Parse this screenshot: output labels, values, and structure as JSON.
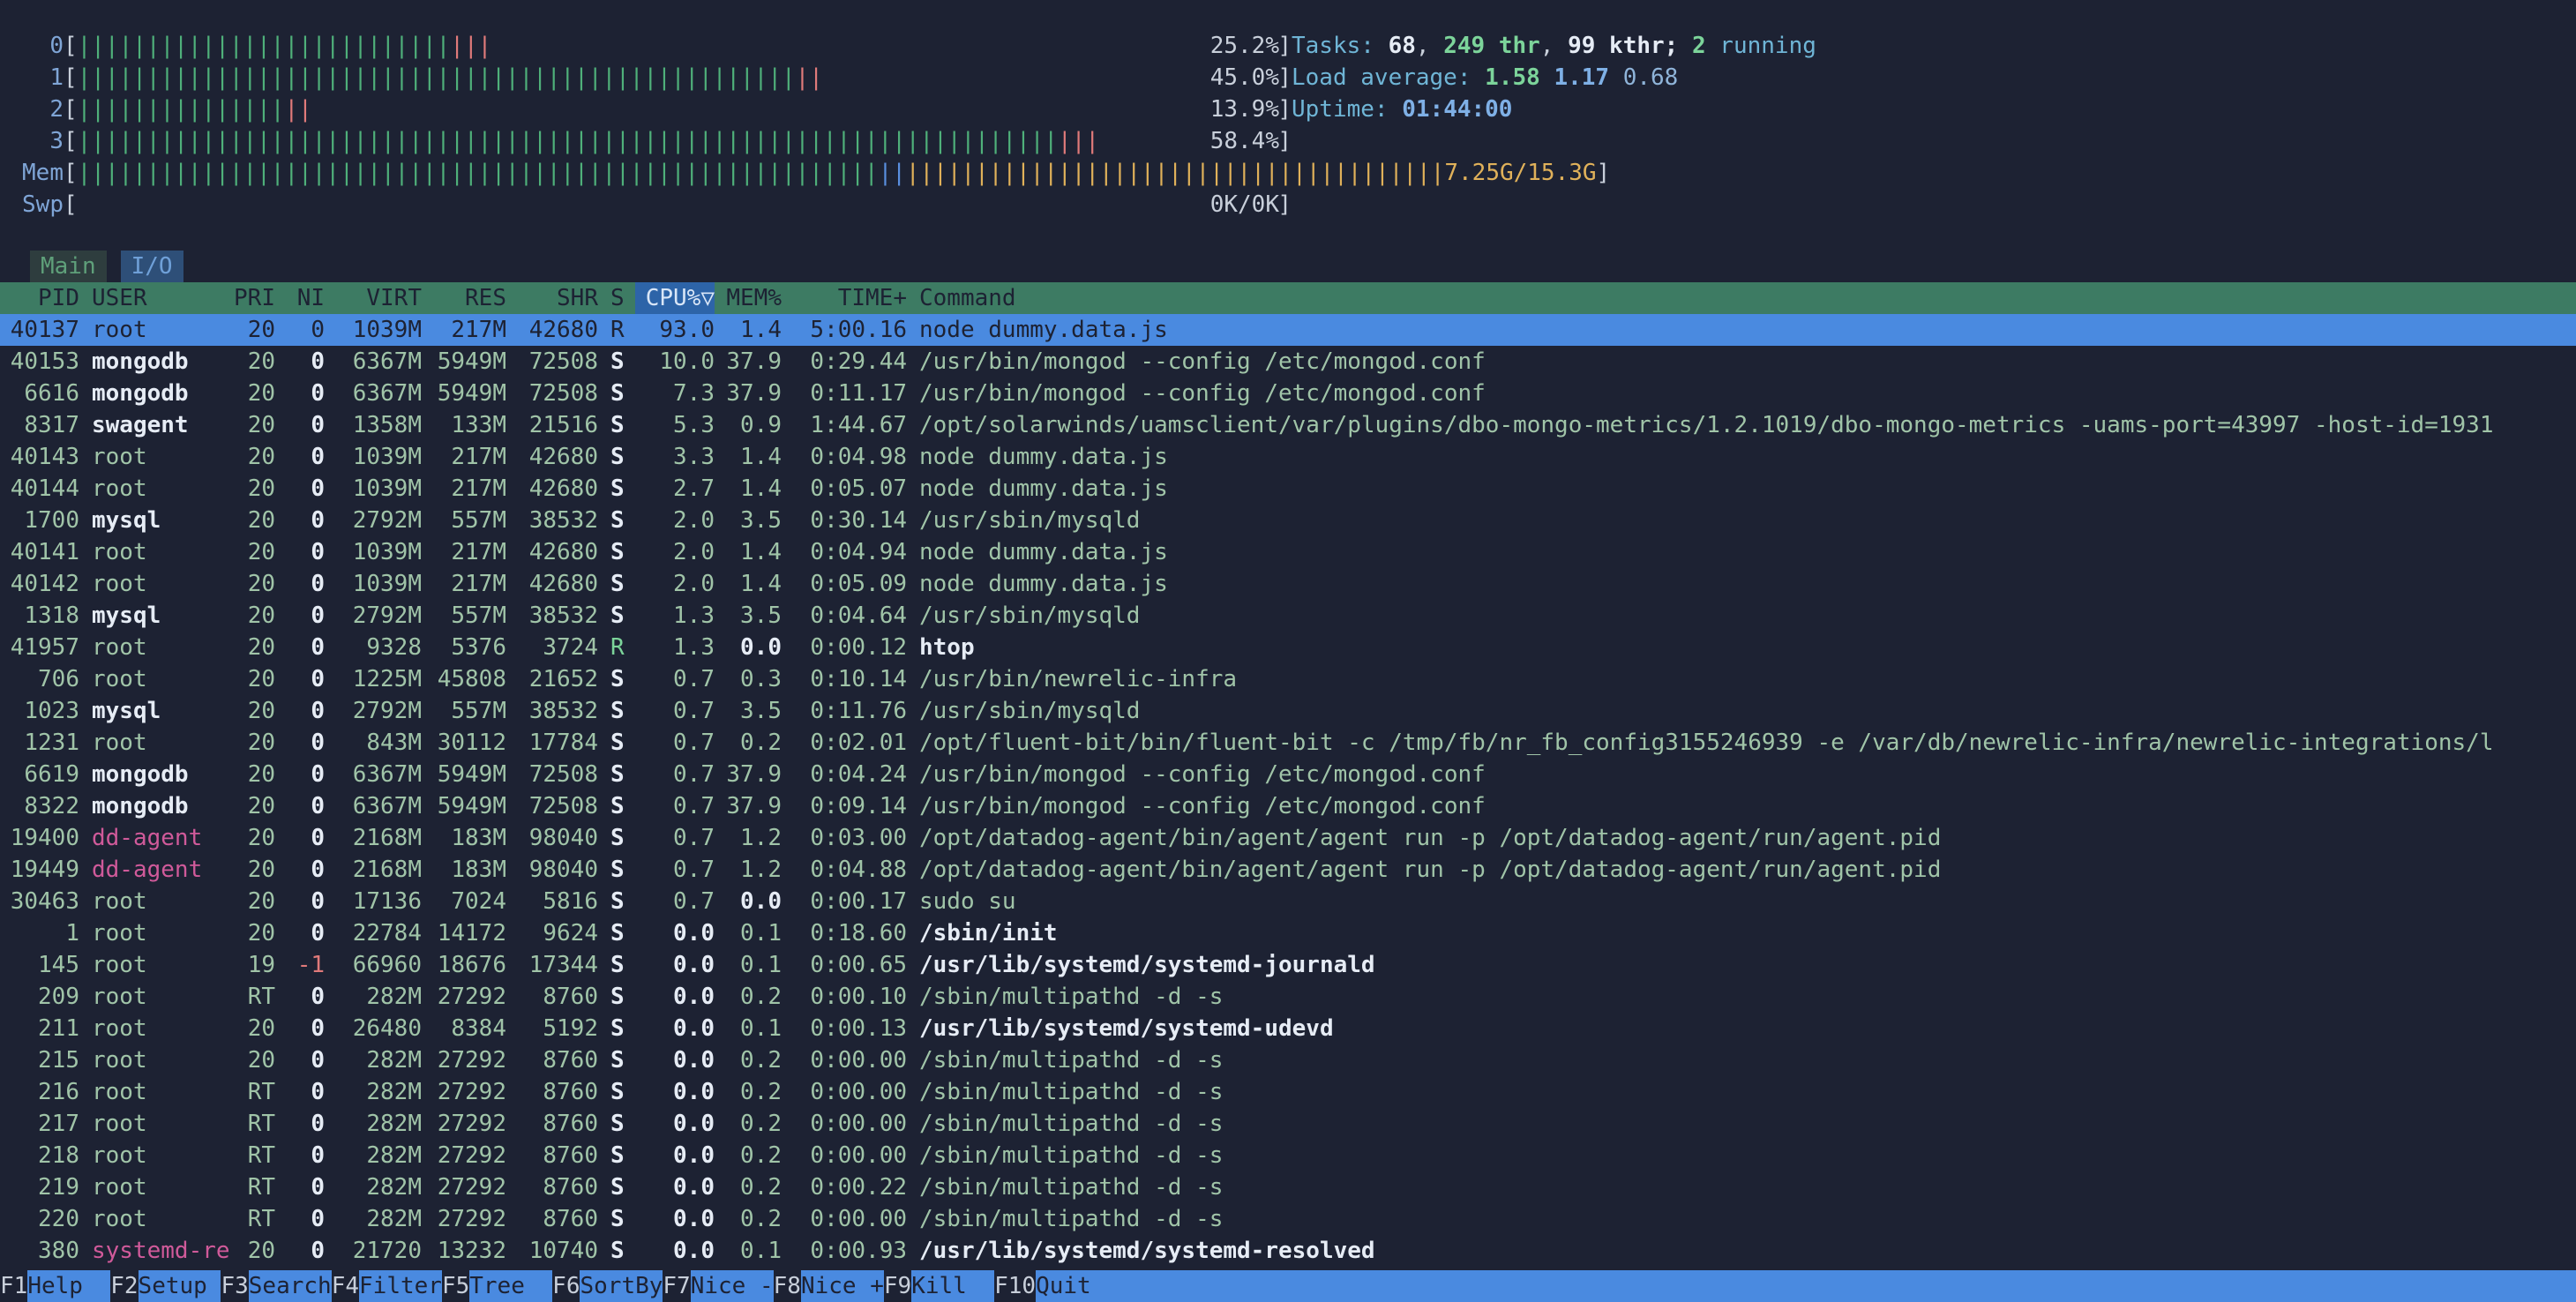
{
  "colors": {
    "background": "#1d2233",
    "header_bar": "#3d7b63",
    "selected_row": "#4a8ae0",
    "meter_low": "#4fb07a",
    "meter_high": "#e07a7a"
  },
  "meters": {
    "cpu": [
      {
        "label": "0",
        "green": 27,
        "red": 3,
        "value": "25.2%"
      },
      {
        "label": "1",
        "green": 52,
        "red": 2,
        "value": "45.0%"
      },
      {
        "label": "2",
        "green": 15,
        "red": 2,
        "value": "13.9%"
      },
      {
        "label": "3",
        "green": 71,
        "red": 3,
        "value": "58.4%"
      }
    ],
    "mem": {
      "label": "Mem",
      "green": 58,
      "blue": 2,
      "yellow": 39,
      "value": "7.25G/15.3G"
    },
    "swap": {
      "label": "Swp",
      "value": "0K/0K"
    }
  },
  "tasks": {
    "label": "Tasks:",
    "count": "68",
    "threads": "249 thr",
    "kthreads": "99 kthr;",
    "running_count": "2",
    "running_label": "running"
  },
  "load": {
    "label": "Load average:",
    "v1": "1.58",
    "v5": "1.17",
    "v15": "0.68"
  },
  "uptime": {
    "label": "Uptime:",
    "value": "01:44:00"
  },
  "tabs": {
    "main": "Main",
    "io": "I/O"
  },
  "columns": {
    "pid": "PID",
    "user": "USER",
    "pri": "PRI",
    "ni": "NI",
    "virt": "VIRT",
    "res": "RES",
    "shr": "SHR",
    "s": "S",
    "cpu": "CPU%▽",
    "mem": "MEM%",
    "time": "TIME+",
    "command": "Command"
  },
  "processes": [
    {
      "pid": "40137",
      "user": "root",
      "pri": "20",
      "ni": "0",
      "virt": "1039M",
      "res": "217M",
      "shr": "42680",
      "s": "R",
      "cpu": "93.0",
      "mem": "1.4",
      "time": "5:00.16",
      "cmd": "node dummy.data.js"
    },
    {
      "pid": "40153",
      "user": "mongodb",
      "pri": "20",
      "ni": "0",
      "virt": "6367M",
      "res": "5949M",
      "shr": "72508",
      "s": "S",
      "cpu": "10.0",
      "mem": "37.9",
      "time": "0:29.44",
      "cmd": "/usr/bin/mongod --config /etc/mongod.conf"
    },
    {
      "pid": "6616",
      "user": "mongodb",
      "pri": "20",
      "ni": "0",
      "virt": "6367M",
      "res": "5949M",
      "shr": "72508",
      "s": "S",
      "cpu": "7.3",
      "mem": "37.9",
      "time": "0:11.17",
      "cmd": "/usr/bin/mongod --config /etc/mongod.conf"
    },
    {
      "pid": "8317",
      "user": "swagent",
      "pri": "20",
      "ni": "0",
      "virt": "1358M",
      "res": "133M",
      "shr": "21516",
      "s": "S",
      "cpu": "5.3",
      "mem": "0.9",
      "time": "1:44.67",
      "cmd": "/opt/solarwinds/uamsclient/var/plugins/dbo-mongo-metrics/1.2.1019/dbo-mongo-metrics -uams-port=43997 -host-id=1931"
    },
    {
      "pid": "40143",
      "user": "root",
      "pri": "20",
      "ni": "0",
      "virt": "1039M",
      "res": "217M",
      "shr": "42680",
      "s": "S",
      "cpu": "3.3",
      "mem": "1.4",
      "time": "0:04.98",
      "cmd": "node dummy.data.js"
    },
    {
      "pid": "40144",
      "user": "root",
      "pri": "20",
      "ni": "0",
      "virt": "1039M",
      "res": "217M",
      "shr": "42680",
      "s": "S",
      "cpu": "2.7",
      "mem": "1.4",
      "time": "0:05.07",
      "cmd": "node dummy.data.js"
    },
    {
      "pid": "1700",
      "user": "mysql",
      "pri": "20",
      "ni": "0",
      "virt": "2792M",
      "res": "557M",
      "shr": "38532",
      "s": "S",
      "cpu": "2.0",
      "mem": "3.5",
      "time": "0:30.14",
      "cmd": "/usr/sbin/mysqld"
    },
    {
      "pid": "40141",
      "user": "root",
      "pri": "20",
      "ni": "0",
      "virt": "1039M",
      "res": "217M",
      "shr": "42680",
      "s": "S",
      "cpu": "2.0",
      "mem": "1.4",
      "time": "0:04.94",
      "cmd": "node dummy.data.js"
    },
    {
      "pid": "40142",
      "user": "root",
      "pri": "20",
      "ni": "0",
      "virt": "1039M",
      "res": "217M",
      "shr": "42680",
      "s": "S",
      "cpu": "2.0",
      "mem": "1.4",
      "time": "0:05.09",
      "cmd": "node dummy.data.js"
    },
    {
      "pid": "1318",
      "user": "mysql",
      "pri": "20",
      "ni": "0",
      "virt": "2792M",
      "res": "557M",
      "shr": "38532",
      "s": "S",
      "cpu": "1.3",
      "mem": "3.5",
      "time": "0:04.64",
      "cmd": "/usr/sbin/mysqld"
    },
    {
      "pid": "41957",
      "user": "root",
      "pri": "20",
      "ni": "0",
      "virt": "9328",
      "res": "5376",
      "shr": "3724",
      "s": "R",
      "cpu": "1.3",
      "mem": "0.0",
      "time": "0:00.12",
      "cmd": "htop"
    },
    {
      "pid": "706",
      "user": "root",
      "pri": "20",
      "ni": "0",
      "virt": "1225M",
      "res": "45808",
      "shr": "21652",
      "s": "S",
      "cpu": "0.7",
      "mem": "0.3",
      "time": "0:10.14",
      "cmd": "/usr/bin/newrelic-infra"
    },
    {
      "pid": "1023",
      "user": "mysql",
      "pri": "20",
      "ni": "0",
      "virt": "2792M",
      "res": "557M",
      "shr": "38532",
      "s": "S",
      "cpu": "0.7",
      "mem": "3.5",
      "time": "0:11.76",
      "cmd": "/usr/sbin/mysqld"
    },
    {
      "pid": "1231",
      "user": "root",
      "pri": "20",
      "ni": "0",
      "virt": "843M",
      "res": "30112",
      "shr": "17784",
      "s": "S",
      "cpu": "0.7",
      "mem": "0.2",
      "time": "0:02.01",
      "cmd": "/opt/fluent-bit/bin/fluent-bit -c /tmp/fb/nr_fb_config3155246939 -e /var/db/newrelic-infra/newrelic-integrations/l"
    },
    {
      "pid": "6619",
      "user": "mongodb",
      "pri": "20",
      "ni": "0",
      "virt": "6367M",
      "res": "5949M",
      "shr": "72508",
      "s": "S",
      "cpu": "0.7",
      "mem": "37.9",
      "time": "0:04.24",
      "cmd": "/usr/bin/mongod --config /etc/mongod.conf"
    },
    {
      "pid": "8322",
      "user": "mongodb",
      "pri": "20",
      "ni": "0",
      "virt": "6367M",
      "res": "5949M",
      "shr": "72508",
      "s": "S",
      "cpu": "0.7",
      "mem": "37.9",
      "time": "0:09.14",
      "cmd": "/usr/bin/mongod --config /etc/mongod.conf"
    },
    {
      "pid": "19400",
      "user": "dd-agent",
      "pri": "20",
      "ni": "0",
      "virt": "2168M",
      "res": "183M",
      "shr": "98040",
      "s": "S",
      "cpu": "0.7",
      "mem": "1.2",
      "time": "0:03.00",
      "cmd": "/opt/datadog-agent/bin/agent/agent run -p /opt/datadog-agent/run/agent.pid"
    },
    {
      "pid": "19449",
      "user": "dd-agent",
      "pri": "20",
      "ni": "0",
      "virt": "2168M",
      "res": "183M",
      "shr": "98040",
      "s": "S",
      "cpu": "0.7",
      "mem": "1.2",
      "time": "0:04.88",
      "cmd": "/opt/datadog-agent/bin/agent/agent run -p /opt/datadog-agent/run/agent.pid"
    },
    {
      "pid": "30463",
      "user": "root",
      "pri": "20",
      "ni": "0",
      "virt": "17136",
      "res": "7024",
      "shr": "5816",
      "s": "S",
      "cpu": "0.7",
      "mem": "0.0",
      "time": "0:00.17",
      "cmd": "sudo su"
    },
    {
      "pid": "1",
      "user": "root",
      "pri": "20",
      "ni": "0",
      "virt": "22784",
      "res": "14172",
      "shr": "9624",
      "s": "S",
      "cpu": "0.0",
      "mem": "0.1",
      "time": "0:18.60",
      "cmd": "/sbin/init"
    },
    {
      "pid": "145",
      "user": "root",
      "pri": "19",
      "ni": "-1",
      "virt": "66960",
      "res": "18676",
      "shr": "17344",
      "s": "S",
      "cpu": "0.0",
      "mem": "0.1",
      "time": "0:00.65",
      "cmd": "/usr/lib/systemd/systemd-journald"
    },
    {
      "pid": "209",
      "user": "root",
      "pri": "RT",
      "ni": "0",
      "virt": "282M",
      "res": "27292",
      "shr": "8760",
      "s": "S",
      "cpu": "0.0",
      "mem": "0.2",
      "time": "0:00.10",
      "cmd": "/sbin/multipathd -d -s"
    },
    {
      "pid": "211",
      "user": "root",
      "pri": "20",
      "ni": "0",
      "virt": "26480",
      "res": "8384",
      "shr": "5192",
      "s": "S",
      "cpu": "0.0",
      "mem": "0.1",
      "time": "0:00.13",
      "cmd": "/usr/lib/systemd/systemd-udevd"
    },
    {
      "pid": "215",
      "user": "root",
      "pri": "20",
      "ni": "0",
      "virt": "282M",
      "res": "27292",
      "shr": "8760",
      "s": "S",
      "cpu": "0.0",
      "mem": "0.2",
      "time": "0:00.00",
      "cmd": "/sbin/multipathd -d -s"
    },
    {
      "pid": "216",
      "user": "root",
      "pri": "RT",
      "ni": "0",
      "virt": "282M",
      "res": "27292",
      "shr": "8760",
      "s": "S",
      "cpu": "0.0",
      "mem": "0.2",
      "time": "0:00.00",
      "cmd": "/sbin/multipathd -d -s"
    },
    {
      "pid": "217",
      "user": "root",
      "pri": "RT",
      "ni": "0",
      "virt": "282M",
      "res": "27292",
      "shr": "8760",
      "s": "S",
      "cpu": "0.0",
      "mem": "0.2",
      "time": "0:00.00",
      "cmd": "/sbin/multipathd -d -s"
    },
    {
      "pid": "218",
      "user": "root",
      "pri": "RT",
      "ni": "0",
      "virt": "282M",
      "res": "27292",
      "shr": "8760",
      "s": "S",
      "cpu": "0.0",
      "mem": "0.2",
      "time": "0:00.00",
      "cmd": "/sbin/multipathd -d -s"
    },
    {
      "pid": "219",
      "user": "root",
      "pri": "RT",
      "ni": "0",
      "virt": "282M",
      "res": "27292",
      "shr": "8760",
      "s": "S",
      "cpu": "0.0",
      "mem": "0.2",
      "time": "0:00.22",
      "cmd": "/sbin/multipathd -d -s"
    },
    {
      "pid": "220",
      "user": "root",
      "pri": "RT",
      "ni": "0",
      "virt": "282M",
      "res": "27292",
      "shr": "8760",
      "s": "S",
      "cpu": "0.0",
      "mem": "0.2",
      "time": "0:00.00",
      "cmd": "/sbin/multipathd -d -s"
    },
    {
      "pid": "380",
      "user": "systemd-re",
      "pri": "20",
      "ni": "0",
      "virt": "21720",
      "res": "13232",
      "shr": "10740",
      "s": "S",
      "cpu": "0.0",
      "mem": "0.1",
      "time": "0:00.93",
      "cmd": "/usr/lib/systemd/systemd-resolved"
    }
  ],
  "footer": [
    {
      "key": "F1",
      "label": "Help  "
    },
    {
      "key": "F2",
      "label": "Setup "
    },
    {
      "key": "F3",
      "label": "Search"
    },
    {
      "key": "F4",
      "label": "Filter"
    },
    {
      "key": "F5",
      "label": "Tree  "
    },
    {
      "key": "F6",
      "label": "SortBy"
    },
    {
      "key": "F7",
      "label": "Nice -"
    },
    {
      "key": "F8",
      "label": "Nice +"
    },
    {
      "key": "F9",
      "label": "Kill  "
    },
    {
      "key": "F10",
      "label": "Quit"
    }
  ]
}
